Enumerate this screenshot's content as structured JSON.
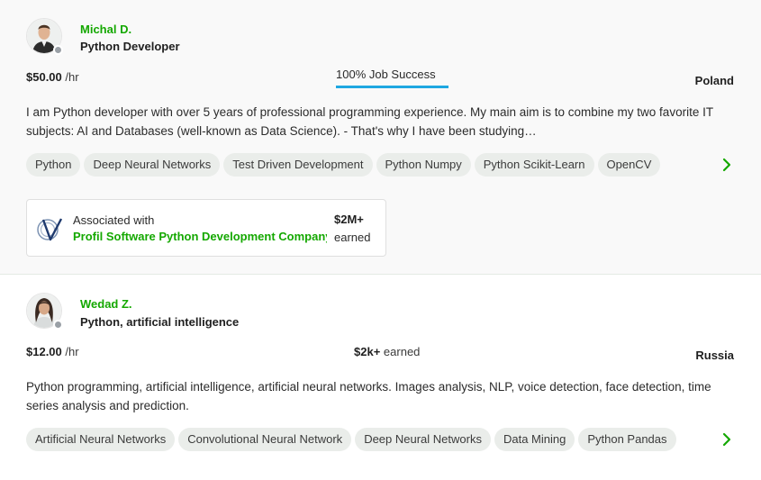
{
  "freelancers": [
    {
      "name": "Michal D.",
      "title": "Python Developer",
      "rate_amount": "$50.00",
      "rate_unit": "/hr",
      "job_success": "100% Job Success",
      "job_success_percent": 100,
      "country": "Poland",
      "description": "I am Python developer with over 5 years of professional programming experience. My main aim is to combine my two favorite IT subjects: AI and Databases (well-known as Data Science). - That's why I have been studying…",
      "skills": [
        "Python",
        "Deep Neural Networks",
        "Test Driven Development",
        "Python Numpy",
        "Python Scikit-Learn",
        "OpenCV"
      ],
      "association": {
        "label": "Associated with",
        "company": "Profil Software Python Development Company",
        "amount": "$2M+",
        "earned_label": "earned"
      },
      "avatar_icon": "person-avatar-icon",
      "status_color": "#9aa0a6"
    },
    {
      "name": "Wedad Z.",
      "title": "Python, artificial intelligence",
      "rate_amount": "$12.00",
      "rate_unit": "/hr",
      "earned_amount": "$2k+",
      "earned_label": "earned",
      "country": "Russia",
      "description": "Python programming, artificial intelligence, artificial neural networks. Images analysis, NLP, voice detection, face detection, time series analysis and prediction.",
      "skills": [
        "Artificial Neural Networks",
        "Convolutional Neural Network",
        "Deep Neural Networks",
        "Data Mining",
        "Python Pandas"
      ],
      "avatar_icon": "person-avatar-icon",
      "status_color": "#9aa0a6"
    }
  ],
  "colors": {
    "accent_green": "#14a800",
    "job_success_bar": "#1ea7e1",
    "chip_bg": "#eaedea"
  }
}
